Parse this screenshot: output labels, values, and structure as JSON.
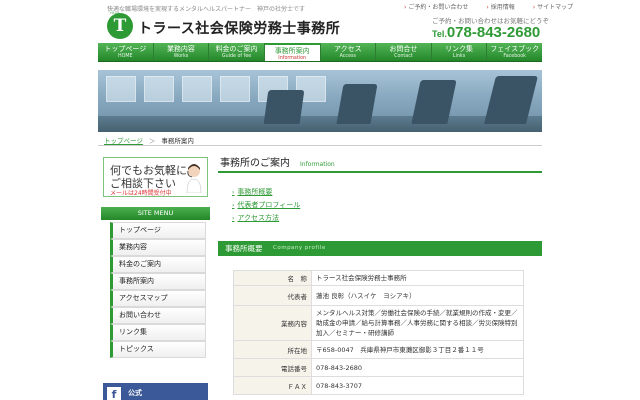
{
  "header": {
    "tagline": "快適な職場環境を実現するメンタルヘルスパートナー　神戸の社労士です",
    "logo_text": "トラース社会保険労務士事務所",
    "logo_mark_letter": "T",
    "logo_mark_caption": "TRAS",
    "utility_links": [
      "ご予約・お問い合わせ",
      "採用情報",
      "サイトマップ"
    ],
    "contact_caption": "ご予約・お問い合わせはお気軽にどうぞ",
    "tel_prefix": "Tel.",
    "tel_number": "078-843-2680"
  },
  "nav": {
    "items": [
      {
        "ja": "トップページ",
        "en": "HOME"
      },
      {
        "ja": "業務内容",
        "en": "Works"
      },
      {
        "ja": "料金のご案内",
        "en": "Guide of fee"
      },
      {
        "ja": "事務所案内",
        "en": "Information"
      },
      {
        "ja": "アクセス",
        "en": "Access"
      },
      {
        "ja": "お問合せ",
        "en": "Contact"
      },
      {
        "ja": "リンク集",
        "en": "Links"
      },
      {
        "ja": "フェイスブック",
        "en": "Facebook"
      }
    ],
    "active_index": 3
  },
  "breadcrumb": {
    "home": "トップページ",
    "separator": "＞",
    "current": "事務所案内"
  },
  "sidebar": {
    "banner": {
      "line1": "何でもお気軽に",
      "line2": "ご相談下さい",
      "line3": "メールは24時間受付中"
    },
    "menu_title": "SITE MENU",
    "menu_items": [
      "トップページ",
      "業務内容",
      "料金のご案内",
      "事務所案内",
      "アクセスマップ",
      "お問い合わせ",
      "リンク集",
      "トピックス"
    ],
    "facebook_label": "公式",
    "facebook_icon_letter": "f"
  },
  "main": {
    "title": "事務所のご案内",
    "title_en": "Information",
    "links": [
      "事務所概要",
      "代表者プロフィール",
      "アクセス方法"
    ],
    "section_title": "事務所概要",
    "section_title_en": "Company profile",
    "profile_rows": [
      {
        "label": "名　称",
        "value": "トラース社会保険労務士事務所"
      },
      {
        "label": "代表者",
        "value": "蓮池 良彰（ハスイケ　ヨシアキ）"
      },
      {
        "label": "業務内容",
        "value": "メンタルヘルス対策／労働社会保険の手続／就業規則の作成・変更／助成金の申請／給与計算事務／人事労務に関する相談／労災保険特別加入／セミナー・研修講師"
      },
      {
        "label": "所在地",
        "value": "〒658-0047　兵庫県神戸市東灘区御影３丁目２番１１号"
      },
      {
        "label": "電話番号",
        "value": "078-843-2680"
      },
      {
        "label": "ＦＡＸ",
        "value": "078-843-3707"
      }
    ]
  },
  "colors": {
    "brand_green": "#2e9a35",
    "facebook_blue": "#3b5998",
    "accent_red": "#cc3333"
  }
}
